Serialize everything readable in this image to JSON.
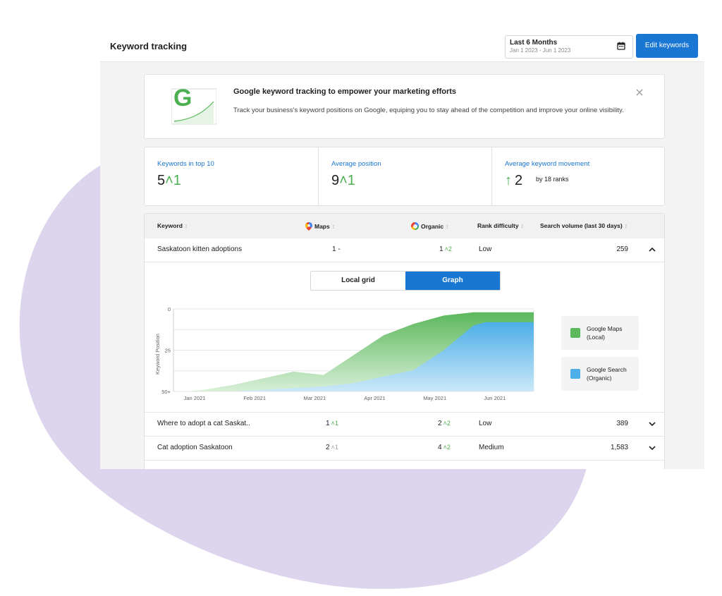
{
  "header": {
    "title": "Keyword tracking",
    "date_label": "Last 6 Months",
    "date_range": "Jan 1 2023 - Jun 1 2023",
    "edit_button": "Edit keywords"
  },
  "promo": {
    "logo_letter": "G",
    "title": "Google keyword tracking to empower your marketing efforts",
    "text": "Track your business's keyword positions on Google, equiping you to stay ahead of the competition and improve your online visibility."
  },
  "stats": [
    {
      "label": "Keywords in top 10",
      "value": "5",
      "change": "˄1"
    },
    {
      "label": "Average position",
      "value": "9",
      "change": "˄1"
    },
    {
      "label": "Average keyword movement",
      "arrow": "↑",
      "value": "2",
      "sub": "by 18 ranks"
    }
  ],
  "table": {
    "headers": {
      "keyword": "Keyword",
      "maps": "Maps",
      "organic": "Organic",
      "difficulty": "Rank difficulty",
      "volume": "Search volume (last 30 days)",
      "sort_icon": "↕"
    },
    "rows": [
      {
        "keyword": "Saskatoon kitten adoptions",
        "maps": "1",
        "maps_change": "-",
        "organic": "1",
        "organic_change": "˄2",
        "difficulty": "Low",
        "volume": "259"
      },
      {
        "keyword": "Where to adopt a cat Saskat..",
        "maps": "1",
        "maps_change": "˄1",
        "organic": "2",
        "organic_change": "˄2",
        "difficulty": "Low",
        "volume": "389"
      },
      {
        "keyword": "Cat adoption Saskatoon",
        "maps": "2",
        "maps_change": "˄1",
        "organic": "4",
        "organic_change": "˄2",
        "difficulty": "Medium",
        "volume": "1,583"
      }
    ],
    "toggle": {
      "local": "Local grid",
      "graph": "Graph"
    }
  },
  "legend": [
    {
      "label": "Google Maps (Local)",
      "color": "#5cb85c"
    },
    {
      "label": "Google Search (Organic)",
      "color": "#4daee8"
    }
  ],
  "colors": {
    "accent": "#1976d2",
    "positive": "#4caf50",
    "blob": "#ddd5ee"
  },
  "icons": {
    "calendar": "calendar-icon",
    "close": "close-icon",
    "maps": "map-pin-icon",
    "organic": "google-g-icon",
    "collapse": "chevron-up-icon",
    "expand": "chevron-down-icon"
  },
  "chart_data": {
    "type": "area",
    "title": "",
    "xlabel": "",
    "ylabel": "Keyword Position",
    "categories": [
      "Jan 2021",
      "Feb 2021",
      "Mar 2021",
      "Apr 2021",
      "May 2021",
      "Jun 2021"
    ],
    "x": [
      0,
      0.2,
      0.5,
      1,
      1.5,
      2,
      2.5,
      3,
      3.5,
      4,
      4.5,
      5,
      5.2,
      5.5,
      5.75,
      6
    ],
    "y_ticks": [
      "0",
      "25",
      "50+"
    ],
    "ylim": [
      0,
      50
    ],
    "y_inverted": true,
    "series": [
      {
        "name": "Google Maps (Local)",
        "values": [
          50,
          50,
          49,
          46,
          42,
          38,
          40,
          28,
          16,
          9,
          4,
          2,
          2,
          2,
          2,
          2
        ]
      },
      {
        "name": "Google Search (Organic)",
        "values": [
          50,
          50,
          50,
          50,
          49,
          48,
          47,
          45,
          41,
          37,
          25,
          10,
          8,
          8,
          8,
          8
        ]
      }
    ]
  }
}
